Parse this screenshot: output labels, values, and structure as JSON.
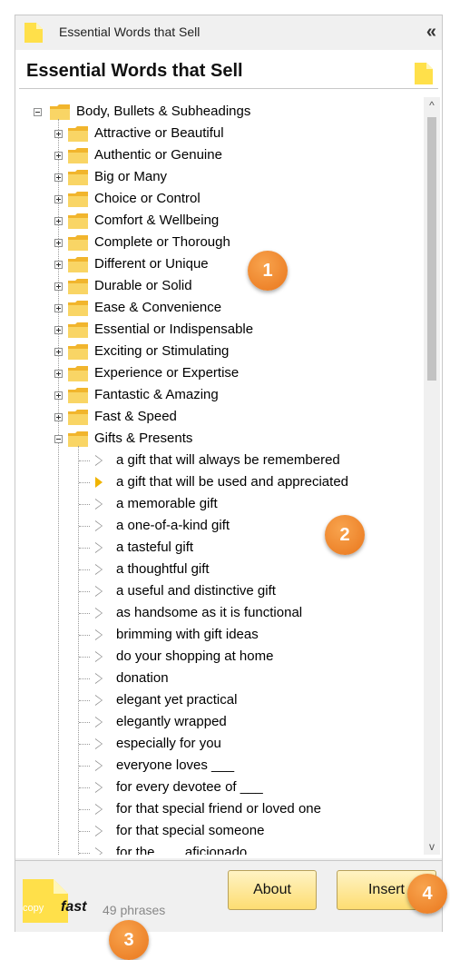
{
  "window": {
    "title": "Essential Words that Sell",
    "collapse_glyph": "«"
  },
  "panel": {
    "heading": "Essential Words that Sell"
  },
  "tree": {
    "root": "Body, Bullets & Subheadings",
    "folders": [
      "Attractive or Beautiful",
      "Authentic or Genuine",
      "Big or Many",
      "Choice or Control",
      "Comfort & Wellbeing",
      "Complete or Thorough",
      "Different or Unique",
      "Durable or Solid",
      "Ease & Convenience",
      "Essential or Indispensable",
      "Exciting  or Stimulating",
      "Experience or Expertise",
      "Fantastic & Amazing",
      "Fast & Speed"
    ],
    "open_folder": "Gifts & Presents",
    "phrases": [
      "a gift that will always be remembered",
      "a gift that will be used and appreciated",
      "a memorable gift",
      "a one-of-a-kind gift",
      "a tasteful gift",
      "a thoughtful gift",
      "a useful and distinctive gift",
      "as handsome as it is functional",
      "brimming with gift ideas",
      "do your shopping at home",
      "donation",
      "elegant yet practical",
      "elegantly wrapped",
      "especially for you",
      "everyone loves ___",
      "for every devotee of ___",
      "for that special friend or loved one",
      "for that special someone",
      "for the ___ aficionado"
    ],
    "selected_phrase": "a gift that will be used and appreciated"
  },
  "scroll": {
    "up_glyph": "^",
    "down_glyph": "v"
  },
  "footer": {
    "logo_copy": "copy",
    "logo_fast": "fast",
    "phrase_count": "49 phrases",
    "about_label": "About",
    "insert_label": "Insert"
  },
  "badges": [
    "1",
    "2",
    "3",
    "4"
  ],
  "colors": {
    "selection": "#3399ff",
    "folder": "#f7c948",
    "badge": "#ee8326",
    "button": "#fde48a"
  }
}
